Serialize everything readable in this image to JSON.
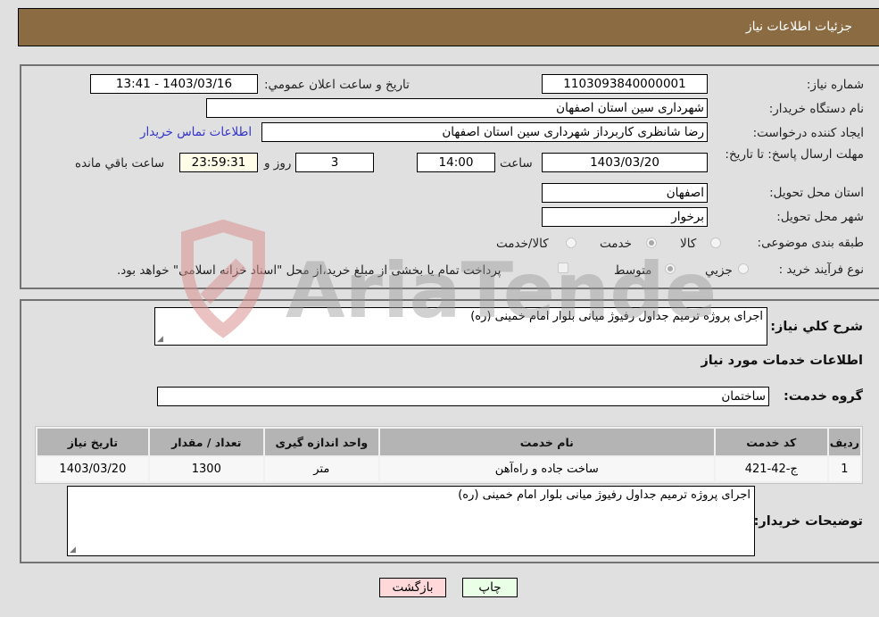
{
  "header": {
    "title": "جزئیات اطلاعات نیاز"
  },
  "details": {
    "need_number": {
      "label": "شماره نیاز:",
      "value": "1103093840000001"
    },
    "announce_datetime": {
      "label": "تاریخ و ساعت اعلان عمومي:",
      "value": "1403/03/16 - 13:41"
    },
    "buyer_org": {
      "label": "نام دستگاه خریدار:",
      "value": "شهرداری سین استان اصفهان"
    },
    "requester": {
      "label": "ایجاد کننده درخواست:",
      "value": "رضا شانظری کاربرداز شهرداری سین استان اصفهان"
    },
    "contact_link": "اطلاعات تماس خریدار",
    "deadline": {
      "label": "مهلت ارسال پاسخ: تا تاریخ:",
      "date": "1403/03/20",
      "time_label": "ساعت",
      "time": "14:00",
      "days": "3",
      "days_label": "روز و",
      "remaining": "23:59:31",
      "remaining_label": "ساعت باقي مانده"
    },
    "delivery_province": {
      "label": "استان محل تحویل:",
      "value": "اصفهان"
    },
    "delivery_city": {
      "label": "شهر محل تحویل:",
      "value": "برخوار"
    },
    "category": {
      "label": "طبقه بندی موضوعی:",
      "options": [
        "کالا",
        "خدمت",
        "کالا/خدمت"
      ],
      "selected": "خدمت"
    },
    "purchase_type": {
      "label": "نوع فرآیند خرید :",
      "options": [
        "جزيي",
        "متوسط"
      ],
      "selected": "متوسط",
      "treasury_checkbox_label": "پرداخت تمام یا بخشی از مبلغ خرید،از محل \"اسناد خزانه اسلامی\" خواهد بود.",
      "treasury_checked": false
    }
  },
  "summary": {
    "description_label": "شرح کلي نياز:",
    "description": "اجرای پروژه ترمیم جداول رفیوژ میانی بلوار امام خمینی (ره)",
    "services_heading": "اطلاعات خدمات مورد نیاز",
    "service_group_label": "گروه خدمت:",
    "service_group": "ساختمان",
    "table": {
      "columns": [
        "ردیف",
        "کد خدمت",
        "نام خدمت",
        "واحد اندازه گیری",
        "تعداد / مقدار",
        "تاریخ نیاز"
      ],
      "rows": [
        [
          "1",
          "ج-42-421",
          "ساخت جاده و راه‌آهن",
          "متر",
          "1300",
          "1403/03/20"
        ]
      ]
    },
    "buyer_notes_label": "توضیحات خریدار:",
    "buyer_notes": "اجرای پروژه ترمیم جداول رفیوژ میانی بلوار امام خمینی (ره)"
  },
  "buttons": {
    "print": "چاپ",
    "back": "بازگشت"
  },
  "watermark": "AriaTender.neT"
}
